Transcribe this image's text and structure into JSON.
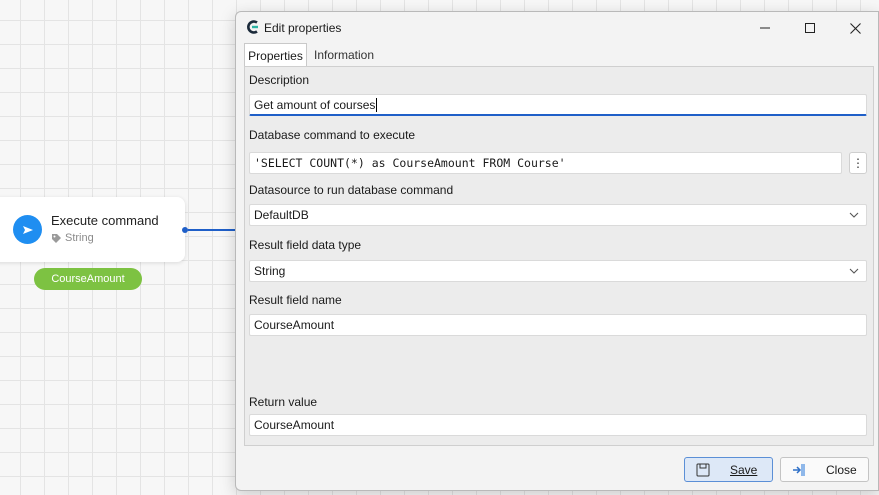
{
  "canvas": {
    "node": {
      "title": "Execute command",
      "type": "String",
      "output_badge": "CourseAmount",
      "icon": "send-icon"
    }
  },
  "dialog": {
    "title": "Edit properties",
    "tabs": [
      {
        "label": "Properties",
        "active": true
      },
      {
        "label": "Information",
        "active": false
      }
    ],
    "fields": {
      "description": {
        "label": "Description",
        "value": "Get amount of courses"
      },
      "db_command": {
        "label": "Database command to execute",
        "value": "'SELECT COUNT(*) as CourseAmount FROM Course'"
      },
      "datasource": {
        "label": "Datasource to run database command",
        "value": "DefaultDB"
      },
      "result_type": {
        "label": "Result field data type",
        "value": "String"
      },
      "result_name": {
        "label": "Result field name",
        "value": "CourseAmount"
      },
      "return_value": {
        "label": "Return value",
        "value": "CourseAmount"
      }
    },
    "more_button_label": "⋮",
    "buttons": {
      "save": "Save",
      "close": "Close"
    }
  },
  "colors": {
    "accent": "#1f5fc8",
    "node_icon": "#1f8ef1",
    "badge": "#7dc242"
  }
}
